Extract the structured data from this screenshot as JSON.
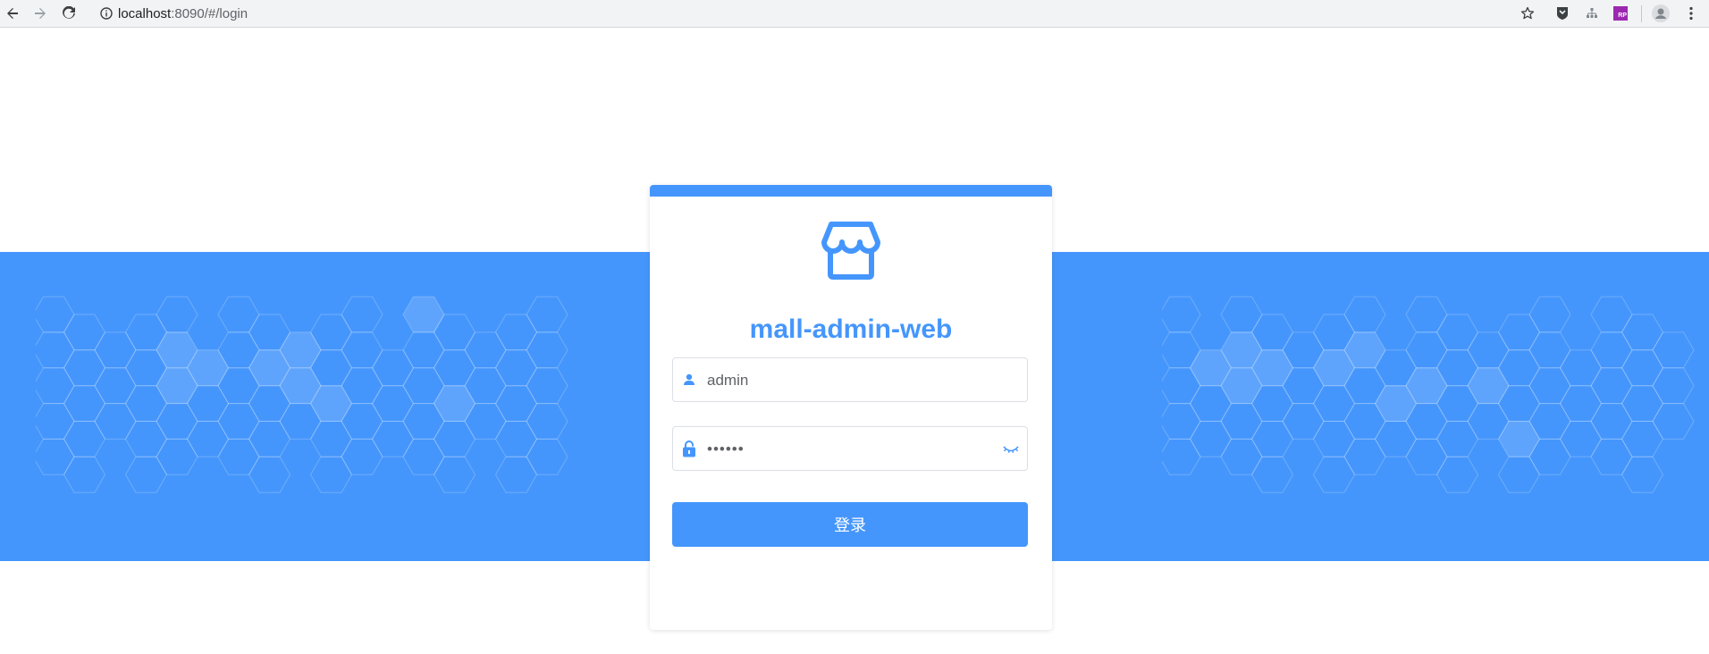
{
  "browser": {
    "url_host": "localhost",
    "url_rest": ":8090/#/login",
    "buttons": [
      "back-icon",
      "forward-icon",
      "reload-icon",
      "star-icon",
      "profile-icon",
      "menu-icon"
    ],
    "extensions": [
      "shield-extension-icon",
      "tree-extension-icon",
      "rp-extension-icon"
    ],
    "extension_rp_label": "RP"
  },
  "login": {
    "title": "mall-admin-web",
    "username_value": "admin",
    "password_value": "••••••",
    "submit_label": "登录"
  },
  "colors": {
    "primary": "#4596fc",
    "toolbar": "#f1f3f4",
    "text": "#606266",
    "rp_extension": "#9c27b0"
  }
}
